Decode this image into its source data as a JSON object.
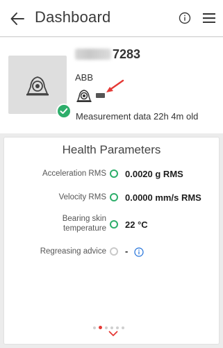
{
  "app_bar": {
    "title": "Dashboard",
    "icons": {
      "back": "back-arrow-icon",
      "info": "info-icon",
      "menu": "menu-icon"
    }
  },
  "device": {
    "serial": "7283",
    "manufacturer": "ABB",
    "measurement_age": "Measurement data 22h 4m old",
    "status": "ok"
  },
  "health": {
    "title": "Health Parameters",
    "params": [
      {
        "label": "Acceleration RMS",
        "value": "0.0020 g RMS",
        "status": "ok"
      },
      {
        "label": "Velocity RMS",
        "value": "0.0000 mm/s RMS",
        "status": "ok"
      },
      {
        "label": "Bearing skin temperature",
        "value": "22 °C",
        "status": "ok"
      },
      {
        "label": "Regreasing advice",
        "value": "-",
        "status": "unknown"
      }
    ]
  },
  "pager": {
    "pages": 6,
    "active": 2
  },
  "colors": {
    "status_ok": "#2eae6b",
    "accent_red": "#e53935",
    "info_blue": "#1e6fd9"
  }
}
